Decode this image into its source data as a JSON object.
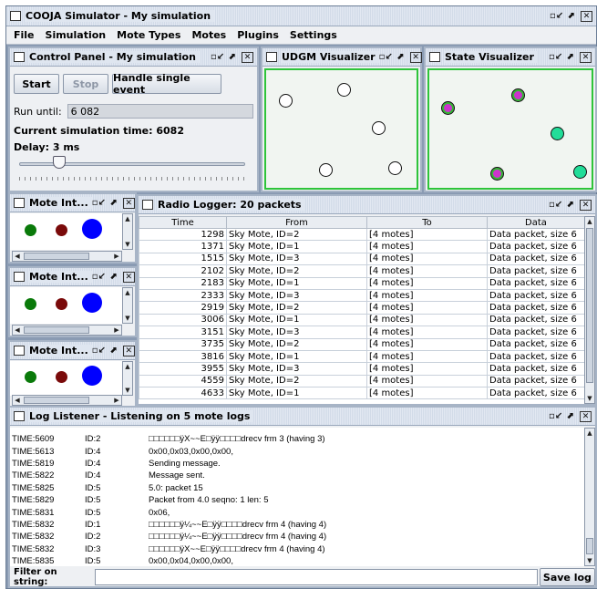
{
  "window": {
    "title": "COOJA Simulator - My simulation"
  },
  "menu": [
    "File",
    "Simulation",
    "Mote Types",
    "Motes",
    "Plugins",
    "Settings"
  ],
  "control": {
    "title": "Control Panel - My simulation",
    "start": "Start",
    "stop": "Stop",
    "single": "Handle single event",
    "run_until_label": "Run until:",
    "run_until_value": "6 082",
    "time_text": "Current simulation time: 6082",
    "delay_text": "Delay: 3 ms",
    "slider_fraction": 0.16
  },
  "udgm": {
    "title": "UDGM Visualizer"
  },
  "state": {
    "title": "State Visualizer"
  },
  "mote_int": {
    "title": "Mote Int..."
  },
  "radio": {
    "title": "Radio Logger: 20 packets",
    "headers": [
      "Time",
      "From",
      "To",
      "Data"
    ],
    "rows": [
      [
        "1298",
        "Sky Mote, ID=2",
        "[4 motes]",
        "Data packet, size 6"
      ],
      [
        "1371",
        "Sky Mote, ID=1",
        "[4 motes]",
        "Data packet, size 6"
      ],
      [
        "1515",
        "Sky Mote, ID=3",
        "[4 motes]",
        "Data packet, size 6"
      ],
      [
        "2102",
        "Sky Mote, ID=2",
        "[4 motes]",
        "Data packet, size 6"
      ],
      [
        "2183",
        "Sky Mote, ID=1",
        "[4 motes]",
        "Data packet, size 6"
      ],
      [
        "2333",
        "Sky Mote, ID=3",
        "[4 motes]",
        "Data packet, size 6"
      ],
      [
        "2919",
        "Sky Mote, ID=2",
        "[4 motes]",
        "Data packet, size 6"
      ],
      [
        "3006",
        "Sky Mote, ID=1",
        "[4 motes]",
        "Data packet, size 6"
      ],
      [
        "3151",
        "Sky Mote, ID=3",
        "[4 motes]",
        "Data packet, size 6"
      ],
      [
        "3735",
        "Sky Mote, ID=2",
        "[4 motes]",
        "Data packet, size 6"
      ],
      [
        "3816",
        "Sky Mote, ID=1",
        "[4 motes]",
        "Data packet, size 6"
      ],
      [
        "3955",
        "Sky Mote, ID=3",
        "[4 motes]",
        "Data packet, size 6"
      ],
      [
        "4559",
        "Sky Mote, ID=2",
        "[4 motes]",
        "Data packet, size 6"
      ],
      [
        "4633",
        "Sky Mote, ID=1",
        "[4 motes]",
        "Data packet, size 6"
      ]
    ]
  },
  "log": {
    "title": "Log Listener - Listening on 5 mote logs",
    "rows": [
      [
        "TIME:5609",
        "ID:2",
        "□□□□□□ÿX~~E□ÿÿ□□□□drecv frm 3 (having 3)"
      ],
      [
        "TIME:5613",
        "ID:4",
        "0x00,0x03,0x00,0x00,"
      ],
      [
        "TIME:5819",
        "ID:4",
        "Sending message."
      ],
      [
        "TIME:5822",
        "ID:4",
        "Message sent."
      ],
      [
        "TIME:5825",
        "ID:5",
        "5.0: packet 15"
      ],
      [
        "TIME:5829",
        "ID:5",
        "Packet from 4.0 seqno: 1 len: 5"
      ],
      [
        "TIME:5831",
        "ID:5",
        "0x06,"
      ],
      [
        "TIME:5832",
        "ID:1",
        "□□□□□□ÿ¼~~E□ÿÿ□□□□drecv frm 4 (having 4)"
      ],
      [
        "TIME:5832",
        "ID:2",
        "□□□□□□ÿ¼~~E□ÿÿ□□□□drecv frm 4 (having 4)"
      ],
      [
        "TIME:5832",
        "ID:3",
        "□□□□□□ÿX~~E□ÿÿ□□□□drecv frm 4 (having 4)"
      ],
      [
        "TIME:5835",
        "ID:5",
        "0x00,0x04,0x00,0x00,"
      ]
    ],
    "filter_label": "Filter on string:",
    "filter_value": "",
    "save": "Save log"
  },
  "colors": {
    "vis_border": "#2ec43a",
    "mote_green": "#0a7a0a",
    "mote_red": "#7a0a0a",
    "mote_blue": "#0000ff",
    "state_magenta": "#cc33cc",
    "state_cyan": "#22dd99"
  }
}
